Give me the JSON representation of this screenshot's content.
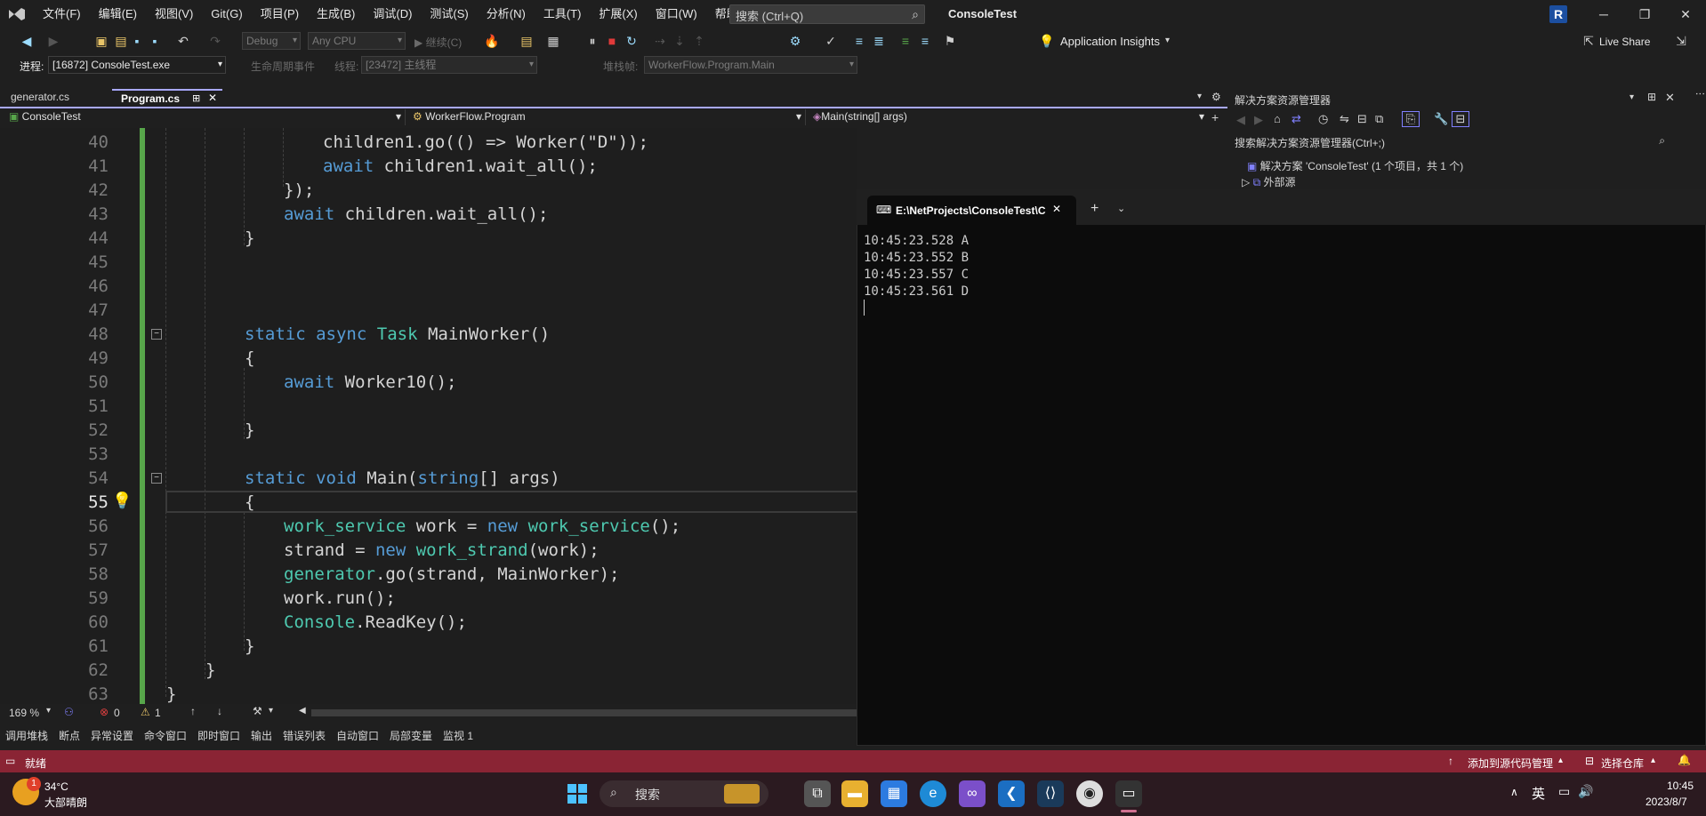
{
  "title_bar": {
    "menus": [
      "文件(F)",
      "编辑(E)",
      "视图(V)",
      "Git(G)",
      "项目(P)",
      "生成(B)",
      "调试(D)",
      "测试(S)",
      "分析(N)",
      "工具(T)",
      "扩展(X)",
      "窗口(W)",
      "帮助(H)"
    ],
    "search_placeholder": "搜索 (Ctrl+Q)",
    "app_title": "ConsoleTest",
    "avatar_letter": "R"
  },
  "toolbar": {
    "config": "Debug",
    "platform": "Any CPU",
    "continue_label": "继续(C)",
    "app_insights": "Application Insights",
    "live_share": "Live Share"
  },
  "debug_bar": {
    "process_label": "进程:",
    "process_value": "[16872] ConsoleTest.exe",
    "lifecycle_label": "生命周期事件",
    "thread_label": "线程:",
    "thread_value": "[23472] 主线程",
    "stackframe_label": "堆栈帧:",
    "stackframe_value": "WorkerFlow.Program.Main"
  },
  "tabs": [
    {
      "label": "generator.cs",
      "active": false
    },
    {
      "label": "Program.cs",
      "active": true
    }
  ],
  "nav": {
    "project": "ConsoleTest",
    "class": "WorkerFlow.Program",
    "member": "Main(string[] args)"
  },
  "editor": {
    "current_line": 55,
    "lines": [
      {
        "num": "40"
      },
      {
        "num": "41"
      },
      {
        "num": "42"
      },
      {
        "num": "43"
      },
      {
        "num": "44"
      },
      {
        "num": "45"
      },
      {
        "num": "46"
      },
      {
        "num": "47"
      },
      {
        "num": "48"
      },
      {
        "num": "49"
      },
      {
        "num": "50"
      },
      {
        "num": "51"
      },
      {
        "num": "52"
      },
      {
        "num": "53"
      },
      {
        "num": "54"
      },
      {
        "num": "55"
      },
      {
        "num": "56"
      },
      {
        "num": "57"
      },
      {
        "num": "58"
      },
      {
        "num": "59"
      },
      {
        "num": "60"
      },
      {
        "num": "61"
      },
      {
        "num": "62"
      },
      {
        "num": "63"
      }
    ],
    "code": {
      "l40": "children1.go(() => Worker(\"D\"));",
      "l41_kw": "await",
      "l41": " children1.wait_all();",
      "l42": "});",
      "l43_kw": "await",
      "l43": " children.wait_all();",
      "l44": "}",
      "l48_kw1": "static",
      "l48_kw2": "async",
      "l48_ty": "Task",
      "l48": " MainWorker()",
      "l49": "{",
      "l50_kw": "await",
      "l50": " Worker10();",
      "l52": "}",
      "l54_kw1": "static",
      "l54_kw2": "void",
      "l54": " Main(",
      "l54_kw3": "string",
      "l54b": "[] args)",
      "l55": "{",
      "l56_ty": "work_service",
      "l56a": " work = ",
      "l56_kw": "new",
      "l56_ty2": "work_service",
      "l56b": "();",
      "l57a": "strand = ",
      "l57_kw": "new",
      "l57_ty": "work_strand",
      "l57b": "(work);",
      "l58_ty": "generator",
      "l58": ".go(strand, MainWorker);",
      "l59": "work.run();",
      "l60_ty": "Console",
      "l60": ".ReadKey();",
      "l61": "}",
      "l62": "}",
      "l63": "}"
    }
  },
  "editor_status": {
    "zoom": "169 %",
    "errors": "0",
    "warnings": "1"
  },
  "tool_tabs": [
    "调用堆栈",
    "断点",
    "异常设置",
    "命令窗口",
    "即时窗口",
    "输出",
    "错误列表",
    "自动窗口",
    "局部变量",
    "监视 1"
  ],
  "solution_explorer": {
    "title": "解决方案资源管理器",
    "search_placeholder": "搜索解决方案资源管理器(Ctrl+;)",
    "solution_node": "解决方案 'ConsoleTest' (1 个项目，共 1 个)",
    "external_node": "外部源"
  },
  "terminal": {
    "tab_title": "E:\\NetProjects\\ConsoleTest\\C",
    "lines": [
      "10:45:23.528 A",
      "10:45:23.552 B",
      "10:45:23.557 C",
      "10:45:23.561 D"
    ]
  },
  "status_bar": {
    "ready": "就绪",
    "source_control": "添加到源代码管理",
    "repo": "选择仓库"
  },
  "taskbar": {
    "weather_temp": "34°C",
    "weather_desc": "大部晴朗",
    "weather_badge": "1",
    "search_label": "搜索",
    "ime": "英",
    "time": "10:45",
    "date": "2023/8/7"
  },
  "colors": {
    "accent": "#a8a8ff",
    "status_bar": "#8a2434",
    "keyword": "#569cd6",
    "type": "#4ec9b0",
    "change_bar": "#57a64a"
  }
}
